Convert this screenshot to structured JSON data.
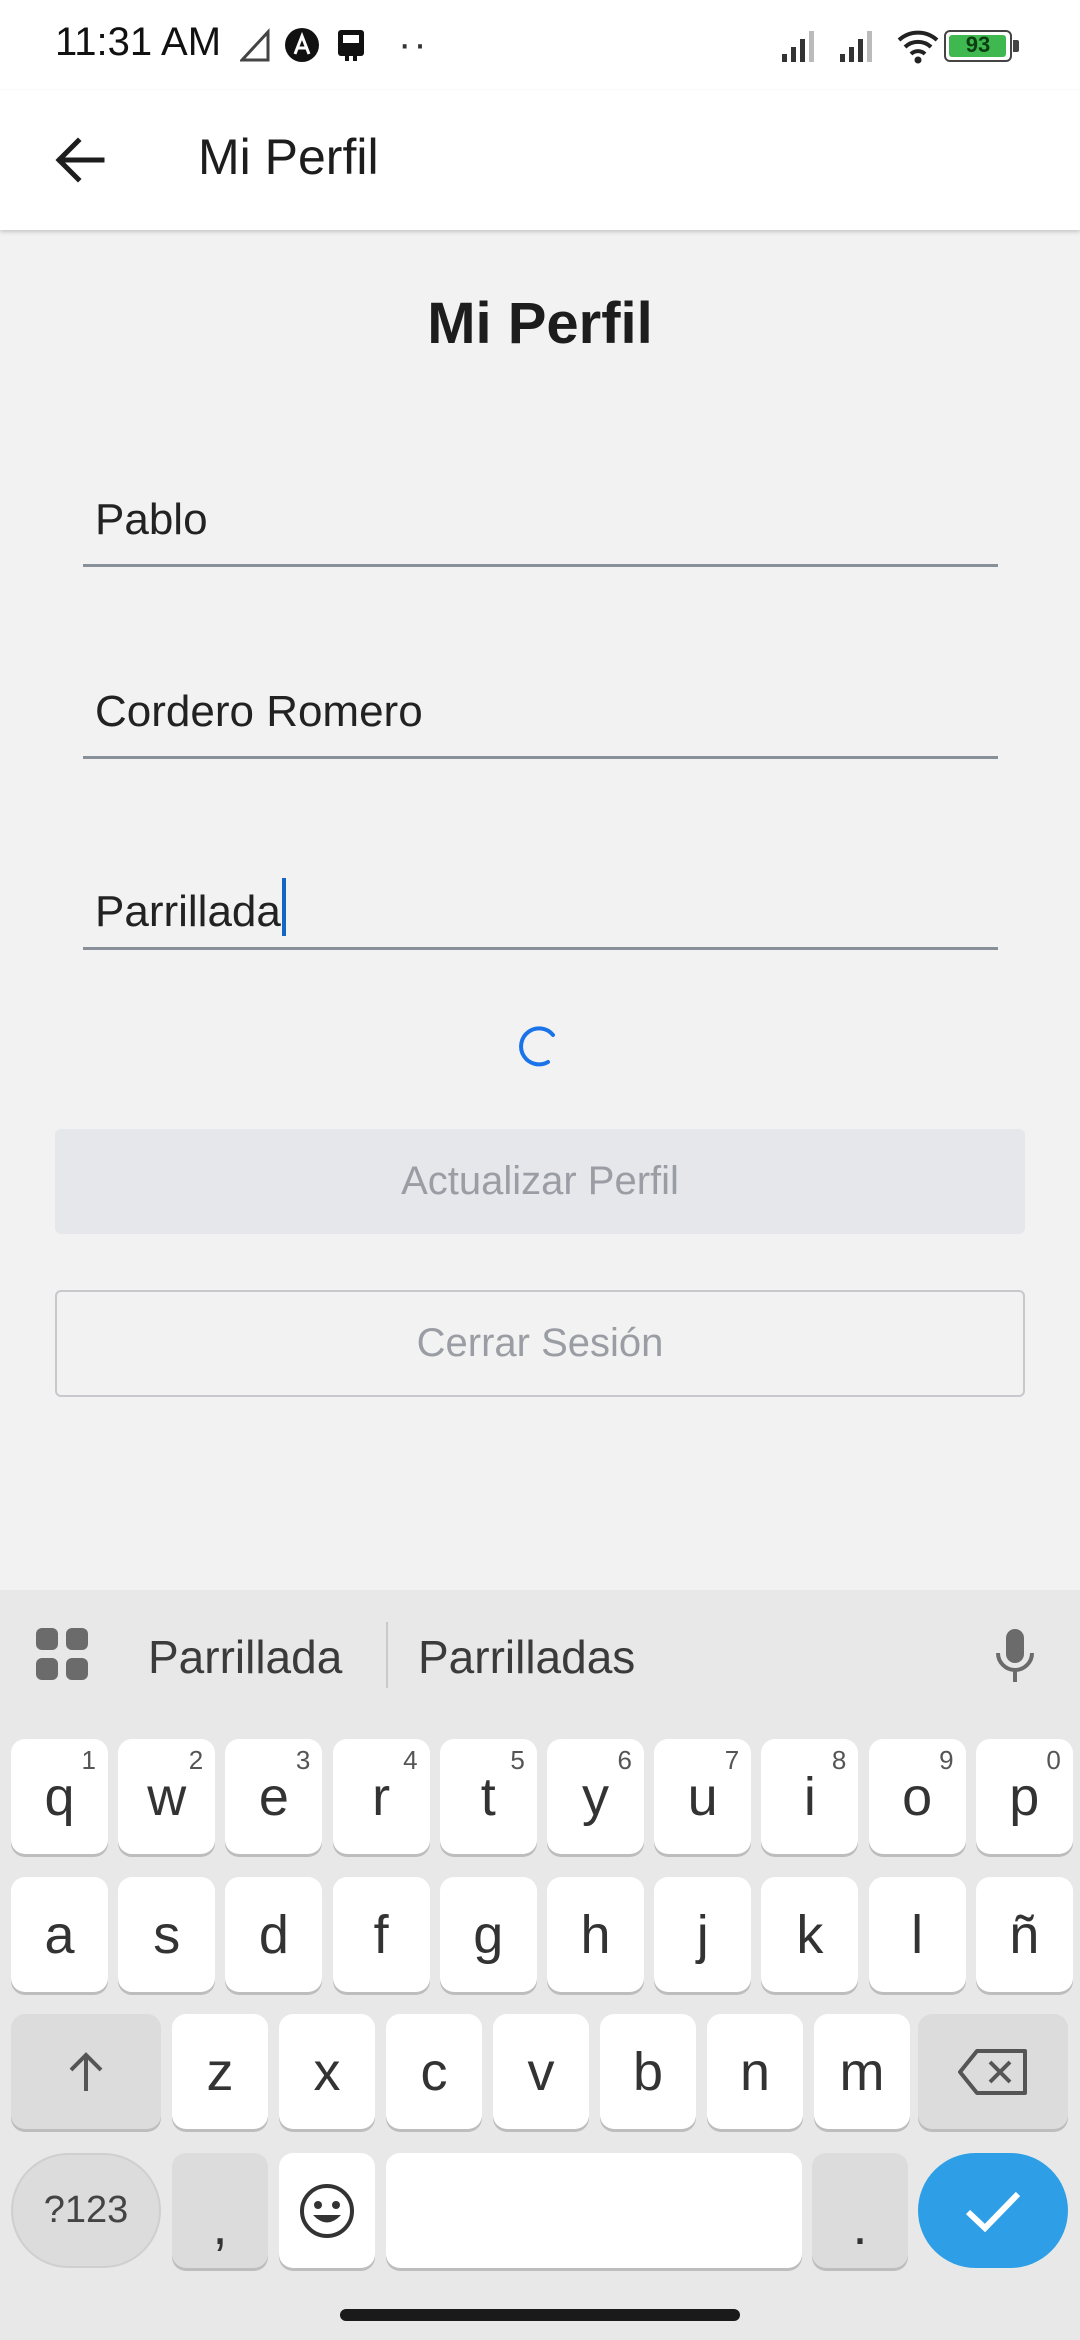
{
  "status_bar": {
    "time": "11:31 AM",
    "dots": "··",
    "battery": "93",
    "battery_color": "#3fb84f"
  },
  "app_bar": {
    "title": "Mi Perfil"
  },
  "content": {
    "title": "Mi Perfil",
    "fields": [
      {
        "value": "Pablo"
      },
      {
        "value": "Cordero Romero"
      },
      {
        "value": "Parrillada"
      }
    ],
    "update_label": "Actualizar Perfil",
    "logout_label": "Cerrar Sesión",
    "spinner_color": "#1a73e8"
  },
  "keyboard": {
    "suggestions": [
      "Parrillada",
      "Parrilladas"
    ],
    "row1": [
      {
        "k": "q",
        "n": "1"
      },
      {
        "k": "w",
        "n": "2"
      },
      {
        "k": "e",
        "n": "3"
      },
      {
        "k": "r",
        "n": "4"
      },
      {
        "k": "t",
        "n": "5"
      },
      {
        "k": "y",
        "n": "6"
      },
      {
        "k": "u",
        "n": "7"
      },
      {
        "k": "i",
        "n": "8"
      },
      {
        "k": "o",
        "n": "9"
      },
      {
        "k": "p",
        "n": "0"
      }
    ],
    "row2": [
      "a",
      "s",
      "d",
      "f",
      "g",
      "h",
      "j",
      "k",
      "l",
      "ñ"
    ],
    "row3": [
      "z",
      "x",
      "c",
      "v",
      "b",
      "n",
      "m"
    ],
    "symbols_label": "?123",
    "comma": ",",
    "period": ".",
    "enter_color": "#2e9fe6"
  }
}
